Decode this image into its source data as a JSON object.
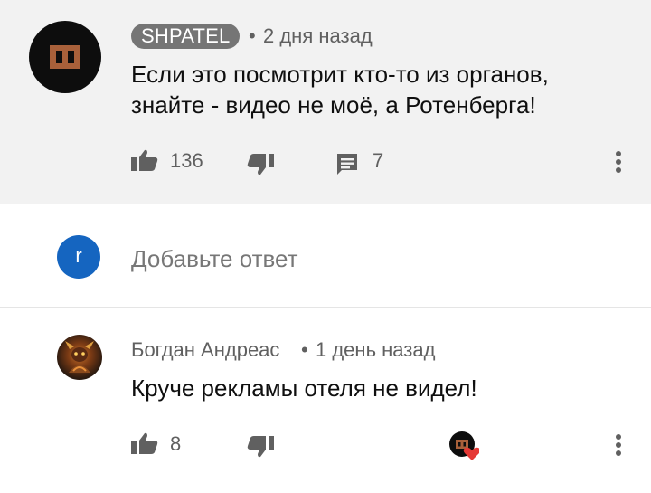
{
  "comment_1": {
    "author": "SHPATEL",
    "time": "2 дня назад",
    "text_line1": "Если это посмотрит кто-то из органов,",
    "text_line2": "знайте - видео не моё, а Ротенберга!",
    "likes": "136",
    "replies": "7",
    "avatar_icon": "sha-letter-avatar"
  },
  "reply_box": {
    "avatar_letter": "r",
    "placeholder": "Добавьте ответ"
  },
  "comment_2": {
    "author": "Богдан Андреас",
    "time": "1 день назад",
    "text": "Круче рекламы отеля не видел!",
    "likes": "8",
    "creator_heart": "creator-heart-icon"
  },
  "colors": {
    "pinned_bg": "#f2f2f2",
    "badge_bg": "#757575",
    "meta_text": "#606060",
    "user_avatar_bg": "#1565c0",
    "heart": "#e53935"
  }
}
